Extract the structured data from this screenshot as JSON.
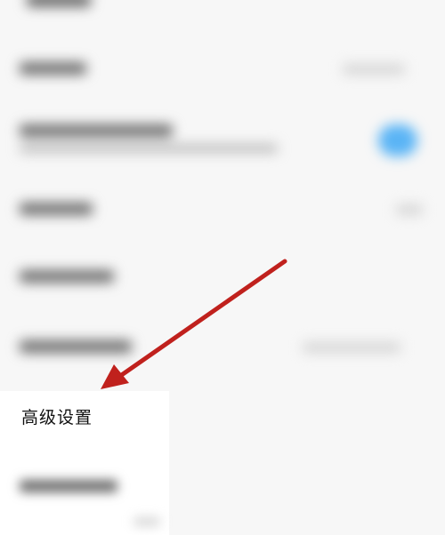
{
  "advanced_settings": {
    "label": "高级设置"
  },
  "annotation": {
    "arrow_color": "#c0211d",
    "toggle_color": "#5ab4f5"
  }
}
